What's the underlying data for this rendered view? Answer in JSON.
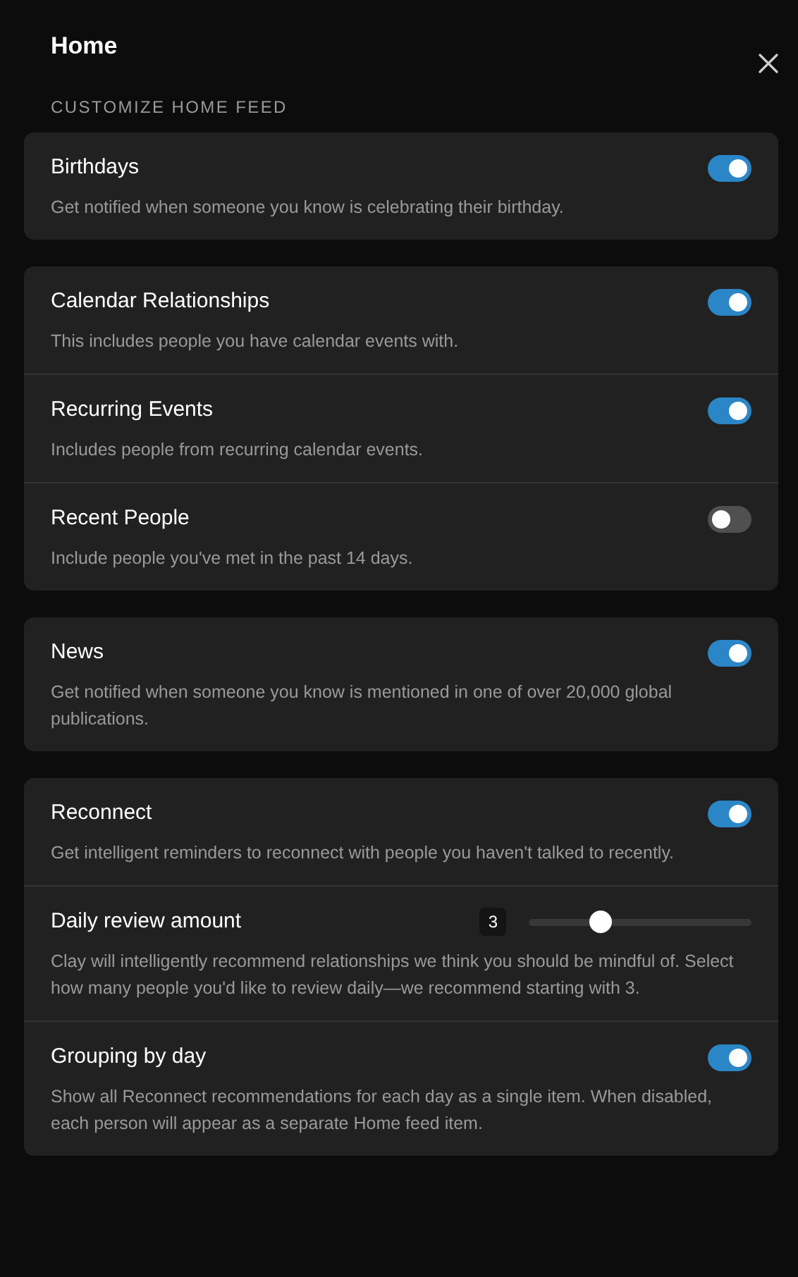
{
  "panel": {
    "title": "Home",
    "section_label": "CUSTOMIZE HOME FEED"
  },
  "groups": [
    {
      "items": [
        {
          "kind": "toggle",
          "label": "Birthdays",
          "description": "Get notified when someone you know is celebrating their birthday.",
          "on": true
        }
      ]
    },
    {
      "items": [
        {
          "kind": "toggle",
          "label": "Calendar Relationships",
          "description": "This includes people you have calendar events with.",
          "on": true
        },
        {
          "kind": "toggle",
          "label": "Recurring Events",
          "description": "Includes people from recurring calendar events.",
          "on": true
        },
        {
          "kind": "toggle",
          "label": "Recent People",
          "description": "Include people you've met in the past 14 days.",
          "on": false
        }
      ]
    },
    {
      "items": [
        {
          "kind": "toggle",
          "label": "News",
          "description": "Get notified when someone you know is mentioned in one of over 20,000 global publications.",
          "on": true
        }
      ]
    },
    {
      "items": [
        {
          "kind": "toggle",
          "label": "Reconnect",
          "description": "Get intelligent reminders to reconnect with people you haven't talked to recently.",
          "on": true
        },
        {
          "kind": "slider",
          "label": "Daily review amount",
          "value": "3",
          "level": 0.32,
          "description": "Clay will intelligently recommend relationships we think you should be mindful of. Select how many people you'd like to review daily—we recommend starting with 3."
        },
        {
          "kind": "toggle",
          "label": "Grouping by day",
          "description": "Show all Reconnect recommendations for each day as a single item. When disabled, each person will appear as a separate Home feed item.",
          "on": true
        }
      ]
    }
  ]
}
